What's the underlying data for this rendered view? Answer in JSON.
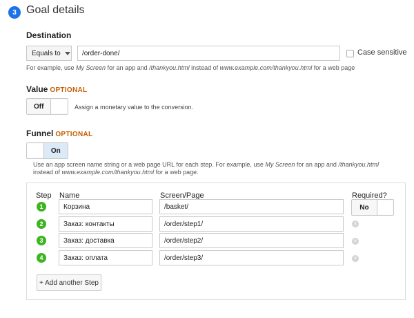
{
  "header": {
    "step_number": "3",
    "title": "Goal details"
  },
  "destination": {
    "label": "Destination",
    "match_type": "Equals to",
    "value": "/order-done/",
    "case_sensitive_label": "Case sensitive",
    "hint": {
      "p1": "For example, use ",
      "i1": "My Screen",
      "p2": " for an app and ",
      "i2": "/thankyou.html",
      "p3": " instead of ",
      "i3": "www.example.com/thankyou.html",
      "p4": " for a web page"
    }
  },
  "value": {
    "label": "Value",
    "optional": "OPTIONAL",
    "toggle_label": "Off",
    "description": "Assign a monetary value to the conversion."
  },
  "funnel": {
    "label": "Funnel",
    "optional": "OPTIONAL",
    "toggle_label": "On",
    "hint1": {
      "p1": "Use an app screen name string or a web page URL for each step. For example, use ",
      "i1": "My Screen",
      "p2": " for an app and ",
      "i2": "/thankyou.html"
    },
    "hint2": {
      "p1": "instead of ",
      "i1": "www.example.com/thankyou.html",
      "p2": " for a web page."
    },
    "columns": {
      "step": "Step",
      "name": "Name",
      "screen": "Screen/Page",
      "required": "Required?"
    },
    "required_toggle_label": "No",
    "steps": [
      {
        "number": "1",
        "name": "Корзина",
        "screen": "/basket/"
      },
      {
        "number": "2",
        "name": "Заказ: контакты",
        "screen": "/order/step1/"
      },
      {
        "number": "3",
        "name": "Заказ: доставка",
        "screen": "/order/step2/"
      },
      {
        "number": "4",
        "name": "Заказ: оплата",
        "screen": "/order/step3/"
      }
    ],
    "add_step_label": "+ Add another Step"
  },
  "colors": {
    "accent": "#1a73e8",
    "optional": "#c45e00",
    "step_badge": "#3cb521"
  }
}
